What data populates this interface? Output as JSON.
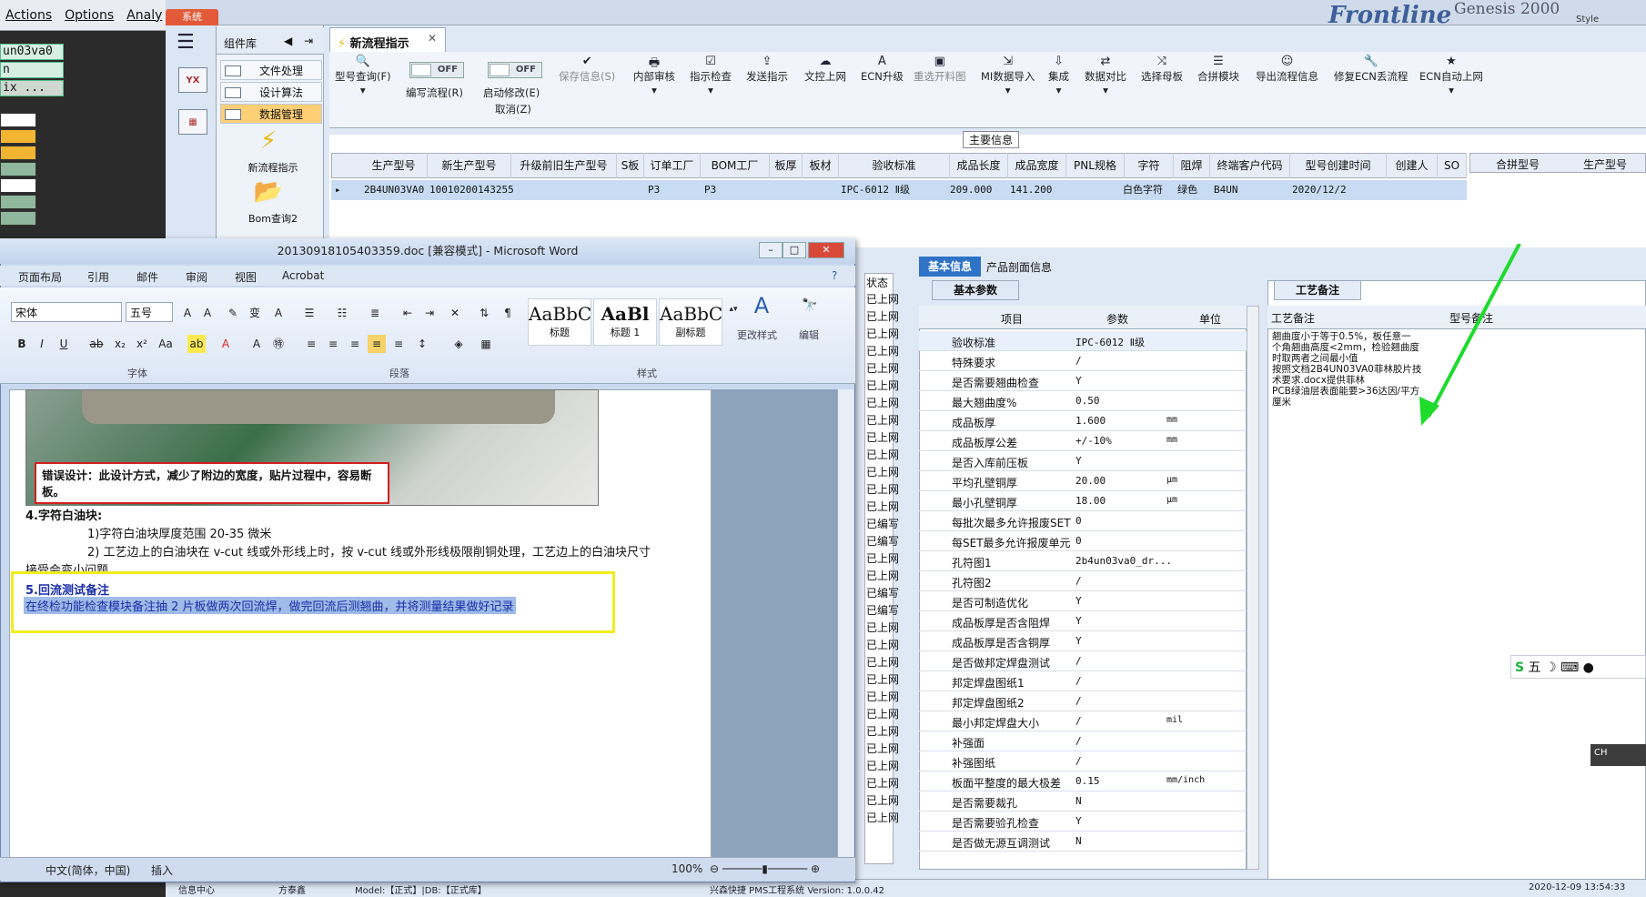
{
  "bg_app": {
    "menu": [
      "Actions",
      "Options",
      "Analy"
    ],
    "cells": [
      "un03va0",
      "n",
      "ix ..."
    ]
  },
  "main_app": {
    "system_tab": "系统",
    "brand": "Frontline",
    "brand2": "Genesis 2000",
    "style_label": "Style",
    "component_library": "组件库",
    "library_items": [
      "文件处理",
      "设计算法",
      "数据管理"
    ],
    "new_flow_label": "新流程指示",
    "bom_query_label": "Bom查询2",
    "tab_title": "新流程指示",
    "toolbar": [
      {
        "label": "型号查询(F)",
        "icon": "search-icon"
      },
      {
        "label": "编写流程(R)",
        "toggle": "OFF"
      },
      {
        "label": "启动修改(E)",
        "sub": "取消(Z)",
        "toggle": "OFF"
      },
      {
        "label": "保存信息(S)",
        "icon": "check-icon",
        "disabled": true
      },
      {
        "label": "内部审核",
        "icon": "printer-icon"
      },
      {
        "label": "指示检查",
        "icon": "checkbox-icon"
      },
      {
        "label": "发送指示",
        "icon": "upload-icon"
      },
      {
        "label": "文控上网",
        "icon": "cloud-upload-icon"
      },
      {
        "label": "ECN升级",
        "icon": "letter-a-icon"
      },
      {
        "label": "重选开料图",
        "icon": "image-icon",
        "disabled": true
      },
      {
        "label": "MI数据导入",
        "icon": "import-icon"
      },
      {
        "label": "集成",
        "icon": "download-icon"
      },
      {
        "label": "数据对比",
        "icon": "compare-icon"
      },
      {
        "label": "选择母板",
        "icon": "shuffle-icon"
      },
      {
        "label": "合拼模块",
        "icon": "list-icon"
      },
      {
        "label": "导出流程信息",
        "icon": "smile-icon"
      },
      {
        "label": "修复ECN丢流程",
        "icon": "wrench-icon"
      },
      {
        "label": "ECN自动上网",
        "icon": "star-icon"
      }
    ],
    "main_info_label": "主要信息",
    "grid_headers": [
      "生产型号",
      "新生产型号",
      "升级前旧生产型号",
      "S板",
      "订单工厂",
      "BOM工厂",
      "板厚",
      "板材",
      "验收标准",
      "成品长度",
      "成品宽度",
      "PNL规格",
      "字符",
      "阻焊",
      "终端客户代码",
      "型号创建时间",
      "创建人",
      "SO"
    ],
    "grid_row": {
      "prod_model": "2B4UN03VA0",
      "new_prod_model": "10010200143255",
      "order_factory": "P3",
      "bom_factory": "P3",
      "accept_std": "IPC-6012 Ⅱ级",
      "length": "209.000",
      "width": "141.200",
      "char": "白色字符",
      "solder": "绿色",
      "cust_code": "B4UN",
      "created": "2020/12/2"
    },
    "merge_headers": [
      "合拼型号",
      "生产型号"
    ],
    "status_header": "状态",
    "status_items": [
      "已上网",
      "已上网",
      "已上网",
      "已上网",
      "已上网",
      "已上网",
      "已上网",
      "已上网",
      "已上网",
      "已上网",
      "已上网",
      "已上网",
      "已上网",
      "已编写",
      "已编写",
      "已上网",
      "已上网",
      "已编写",
      "已编写",
      "已上网",
      "已上网",
      "已上网",
      "已上网",
      "已上网",
      "已上网",
      "已上网",
      "已上网",
      "已上网",
      "已上网",
      "已上网",
      "已上网"
    ],
    "basic_tabs": [
      "基本信息",
      "产品剖面信息"
    ],
    "basic_subtab": "基本参数",
    "param_headers": [
      "项目",
      "参数",
      "单位"
    ],
    "params": [
      {
        "k": "验收标准",
        "v": "IPC-6012 Ⅱ级",
        "u": ""
      },
      {
        "k": "特殊要求",
        "v": "/",
        "u": ""
      },
      {
        "k": "是否需要翘曲检查",
        "v": "Y",
        "u": ""
      },
      {
        "k": "最大翘曲度%",
        "v": "0.50",
        "u": ""
      },
      {
        "k": "成品板厚",
        "v": "1.600",
        "u": "mm"
      },
      {
        "k": "成品板厚公差",
        "v": "+/-10%",
        "u": "mm"
      },
      {
        "k": "是否入库前压板",
        "v": "Y",
        "u": ""
      },
      {
        "k": "平均孔壁铜厚",
        "v": "20.00",
        "u": "μm"
      },
      {
        "k": "最小孔壁铜厚",
        "v": "18.00",
        "u": "μm"
      },
      {
        "k": "每批次最多允许报废SET",
        "v": "0",
        "u": ""
      },
      {
        "k": "每SET最多允许报废单元",
        "v": "0",
        "u": ""
      },
      {
        "k": "孔符图1",
        "v": "2b4un03va0_dr...",
        "u": ""
      },
      {
        "k": "孔符图2",
        "v": "/",
        "u": ""
      },
      {
        "k": "是否可制造优化",
        "v": "Y",
        "u": ""
      },
      {
        "k": "成品板厚是否含阻焊",
        "v": "Y",
        "u": ""
      },
      {
        "k": "成品板厚是否含铜厚",
        "v": "Y",
        "u": ""
      },
      {
        "k": "是否做邦定焊盘测试",
        "v": "/",
        "u": ""
      },
      {
        "k": "邦定焊盘图纸1",
        "v": "/",
        "u": ""
      },
      {
        "k": "邦定焊盘图纸2",
        "v": "/",
        "u": ""
      },
      {
        "k": "最小邦定焊盘大小",
        "v": "/",
        "u": "mil"
      },
      {
        "k": "补强面",
        "v": "/",
        "u": ""
      },
      {
        "k": "补强图纸",
        "v": "/",
        "u": ""
      },
      {
        "k": "板面平整度的最大极差",
        "v": "0.15",
        "u": "mm/inch"
      },
      {
        "k": "是否需要裁孔",
        "v": "N",
        "u": ""
      },
      {
        "k": "是否需要验孔检查",
        "v": "Y",
        "u": ""
      },
      {
        "k": "是否做无源互调测试",
        "v": "N",
        "u": ""
      }
    ],
    "craft_tab": "工艺备注",
    "craft_col": "工艺备注",
    "model_note_col": "型号备注",
    "craft_note": "翘曲度小于等于0.5%，板任意一\n个角翘曲高度<2mm，检验翘曲度\n时取两者之间最小值\n按照文档2B4UN03VA0菲林胶片技\n术要求.docx提供菲林\nPCB绿油层表面能要>36达因/平方\n厘米",
    "ime": "五",
    "ime_ch": "CH",
    "bottom": [
      "信息中心",
      "方泰鑫",
      "Model:【正式】|DB:【正式库】",
      "兴森快捷 PMS工程系统 Version: 1.0.0.42",
      "2020-12-09 13:54:33"
    ]
  },
  "word": {
    "title": "20130918105403359.doc [兼容模式] - Microsoft Word",
    "tabs": [
      "页面布局",
      "引用",
      "邮件",
      "审阅",
      "视图",
      "Acrobat"
    ],
    "font_name": "宋体",
    "font_size": "五号",
    "groups": [
      "字体",
      "段落",
      "样式",
      "编辑"
    ],
    "styles": [
      {
        "sample": "AaBbC",
        "name": "标题"
      },
      {
        "sample": "AaBl",
        "name": "标题 1"
      },
      {
        "sample": "AaBbC",
        "name": "副标题"
      }
    ],
    "change_style": "更改样式",
    "edit": "编辑",
    "error_note": "错误设计：此设计方式，减少了附边的宽度，贴片过程中，容易断板。",
    "h4": "4.字符白油块:",
    "l1": "1)字符白油块厚度范围 20-35 微米",
    "l2": "2) 工艺边上的白油块在 v-cut 线或外形线上时，按 v-cut 线或外形线极限削铜处理，工艺边上的白油块尺寸",
    "l3": "接受会变小问题。",
    "h5": "5.回流测试备注",
    "h5text": "在终检功能检查模块备注抽 2 片板做两次回流焊，做完回流后测翘曲，并将测量结果做好记录",
    "status": {
      "lang": "中文(简体，中国)",
      "insert": "插入",
      "zoom": "100%"
    }
  }
}
